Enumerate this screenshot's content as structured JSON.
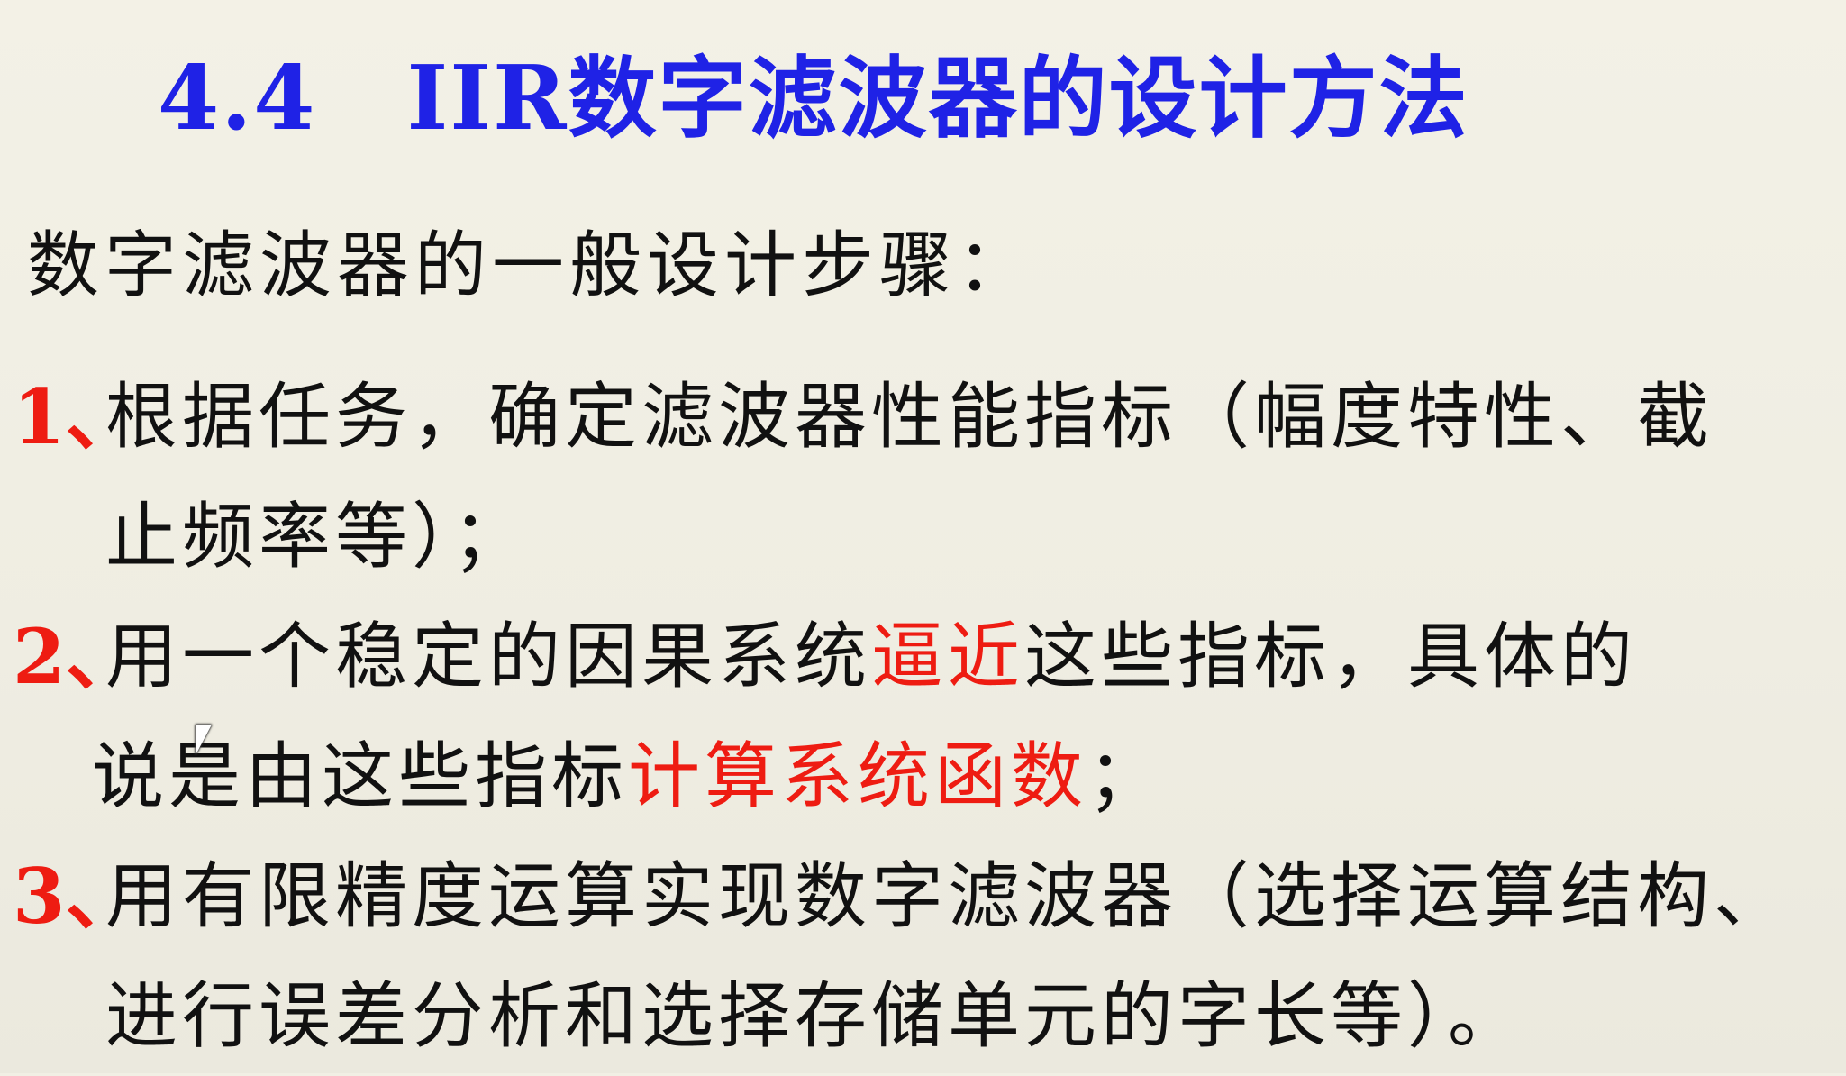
{
  "title": {
    "number": "4.4",
    "iir": "IIR",
    "text": "数字滤波器的设计方法"
  },
  "heading": "数字滤波器的一般设计步骤：",
  "steps": [
    {
      "marker": "1、",
      "line1": "根据任务，确定滤波器性能指标（幅度特性、截",
      "line2": "止频率等）；"
    },
    {
      "marker": "2、",
      "line1_a": "用一个稳定的因果系统",
      "line1_red": "逼近",
      "line1_b": "这些指标，具体的",
      "line2_a": "说是由这些指标",
      "line2_red": "计算系统函数",
      "line2_b": "；"
    },
    {
      "marker": "3、",
      "line1": "用有限精度运算实现数字滤波器（选择运算结构、",
      "line2": "进行误差分析和选择存储单元的字长等）。"
    }
  ],
  "colors": {
    "title": "#1f22e6",
    "highlight": "#ee1c12",
    "text": "#111111",
    "background": "#f1efe4"
  }
}
